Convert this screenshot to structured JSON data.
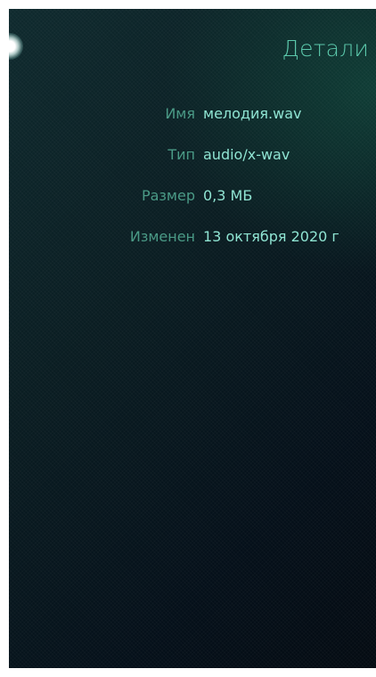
{
  "page": {
    "title": "Детали",
    "accent_color": "#5cc9ac",
    "label_color": "#4a9a86",
    "value_color": "#8fe4d2",
    "pulley_indicator_icon": "pulley-menu-glow-icon"
  },
  "details": [
    {
      "label": "Имя",
      "value": "мелодия.wav"
    },
    {
      "label": "Тип",
      "value": "audio/x-wav"
    },
    {
      "label": "Размер",
      "value": "0,3 МБ"
    },
    {
      "label": "Изменен",
      "value": "13 октября 2020 г"
    }
  ]
}
